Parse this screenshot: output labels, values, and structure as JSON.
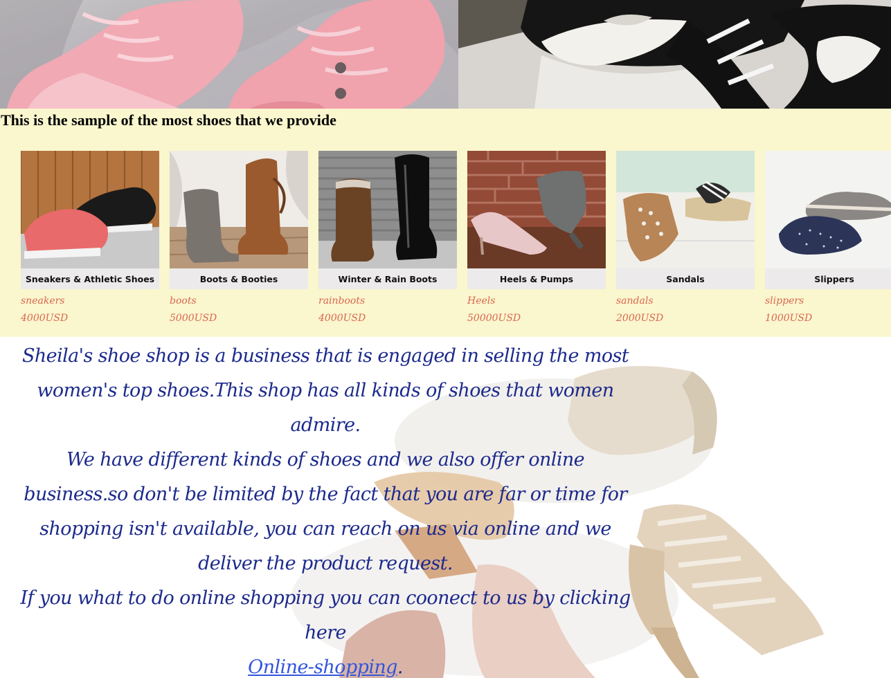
{
  "banner": {
    "title": "This is the sample of the most shoes that we provide"
  },
  "products": [
    {
      "caption": "Sneakers & Athletic Shoes",
      "name": "sneakers",
      "price": "4000USD"
    },
    {
      "caption": "Boots & Booties",
      "name": "boots",
      "price": "5000USD"
    },
    {
      "caption": "Winter & Rain Boots",
      "name": "rainboots",
      "price": "4000USD"
    },
    {
      "caption": "Heels & Pumps",
      "name": "Heels",
      "price": "50000USD"
    },
    {
      "caption": "Sandals",
      "name": "sandals",
      "price": "2000USD"
    },
    {
      "caption": "Slippers",
      "name": "slippers",
      "price": "1000USD"
    }
  ],
  "about": {
    "line1": "Sheila's shoe shop is a business that is engaged in selling the most women's top shoes.This shop has all kinds of shoes that women admire.",
    "line2": "We have different kinds of shoes and we also offer online business.so don't be limited by the fact that you are far or time for shopping isn't available, you can reach on us via online and we deliver the product request.",
    "line3": "If you what to do online shopping you can coonect to us by clicking here",
    "link_text": "Online-shopping",
    "link_suffix": "."
  },
  "colors": {
    "band_bg": "#faf6ce",
    "price_text": "#d9674f",
    "about_text": "#1c2a8c",
    "link": "#3355dd"
  }
}
